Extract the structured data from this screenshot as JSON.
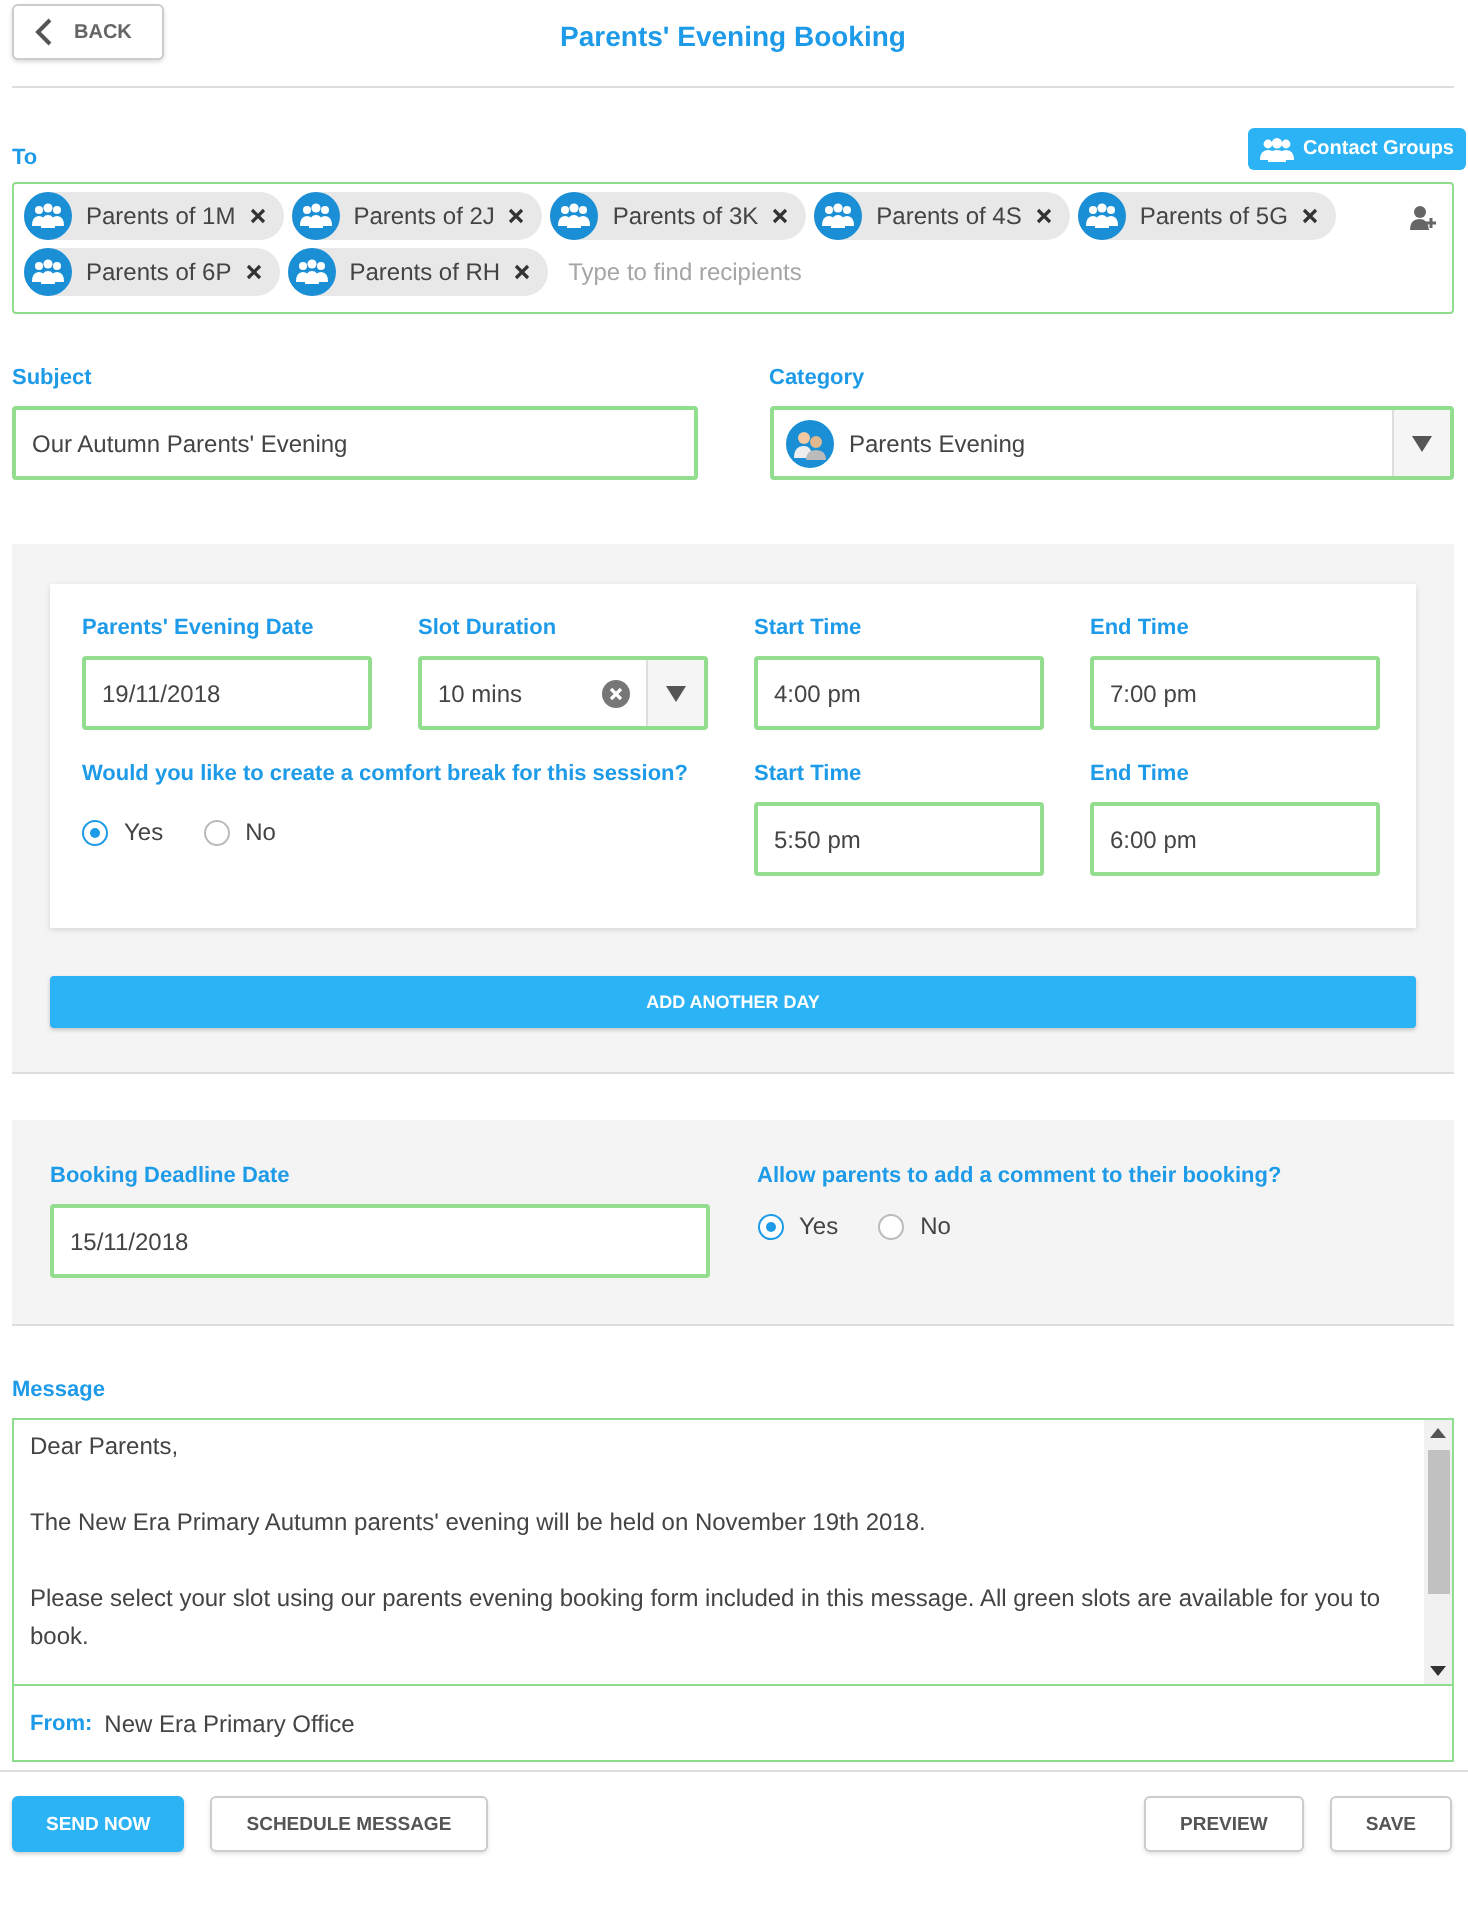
{
  "header": {
    "back_button": "BACK",
    "title": "Parents' Evening Booking"
  },
  "to": {
    "label": "To",
    "contact_groups_button": "Contact Groups",
    "placeholder": "Type to find recipients",
    "recipients": [
      {
        "label": "Parents of 1M"
      },
      {
        "label": "Parents of 2J"
      },
      {
        "label": "Parents of 3K"
      },
      {
        "label": "Parents of 4S"
      },
      {
        "label": "Parents of 5G"
      },
      {
        "label": "Parents of 6P"
      },
      {
        "label": "Parents of RH"
      }
    ]
  },
  "subject": {
    "label": "Subject",
    "value": "Our Autumn Parents' Evening"
  },
  "category": {
    "label": "Category",
    "value": "Parents Evening"
  },
  "session": {
    "fields": [
      {
        "kind": "text",
        "label": "Parents' Evening Date",
        "value": "19/11/2018"
      },
      {
        "kind": "select",
        "label": "Slot Duration",
        "value": "10 mins"
      },
      {
        "kind": "text",
        "label": "Start Time",
        "value": "4:00 pm"
      },
      {
        "kind": "text",
        "label": "End Time",
        "value": "7:00 pm"
      }
    ],
    "comfort_break": {
      "question": "Would you like to create a comfort break for this session?",
      "options": [
        {
          "label": "Yes",
          "selected": true
        },
        {
          "label": "No",
          "selected": false
        }
      ],
      "fields": [
        {
          "label": "Start Time",
          "value": "5:50 pm"
        },
        {
          "label": "End Time",
          "value": "6:00 pm"
        }
      ]
    },
    "add_day_button": "ADD ANOTHER DAY"
  },
  "booking": {
    "deadline": {
      "label": "Booking Deadline Date",
      "value": "15/11/2018"
    },
    "comment": {
      "question": "Allow parents to add a comment to their booking?",
      "options": [
        {
          "label": "Yes",
          "selected": true
        },
        {
          "label": "No",
          "selected": false
        }
      ]
    }
  },
  "message": {
    "label": "Message",
    "paragraphs": [
      "Dear Parents,",
      "The New Era Primary Autumn parents' evening will be held on November 19th 2018.",
      "Please select your slot using our parents evening booking form included in this message. All green slots are available for you to book."
    ],
    "from_label": "From:",
    "from_value": "New Era Primary Office"
  },
  "footer": {
    "left_buttons": [
      {
        "label": "SEND NOW",
        "kind": "primary"
      },
      {
        "label": "SCHEDULE MESSAGE",
        "kind": "secondary"
      }
    ],
    "right_buttons": [
      {
        "label": "PREVIEW",
        "kind": "secondary"
      },
      {
        "label": "SAVE",
        "kind": "secondary"
      }
    ]
  }
}
